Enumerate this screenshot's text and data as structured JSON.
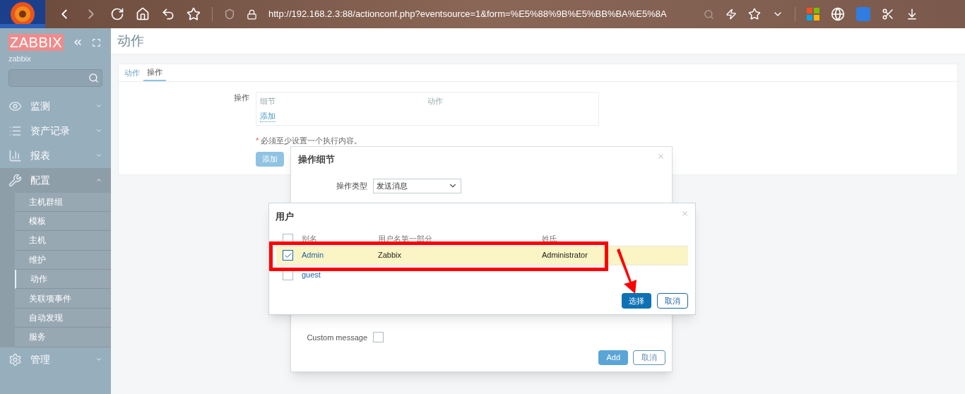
{
  "browser": {
    "url": "http://192.168.2.3:88/actionconf.php?eventsource=1&form=%E5%88%9B%E5%BB%BA%E5%8A"
  },
  "sidebar": {
    "logo": "ZABBIX",
    "user": "zabbix",
    "sections": [
      {
        "label": "监测",
        "expanded": false
      },
      {
        "label": "资产记录",
        "expanded": false
      },
      {
        "label": "报表",
        "expanded": false
      },
      {
        "label": "配置",
        "expanded": true,
        "children": [
          {
            "label": "主机群组",
            "selected": false
          },
          {
            "label": "模板",
            "selected": false
          },
          {
            "label": "主机",
            "selected": false
          },
          {
            "label": "维护",
            "selected": false
          },
          {
            "label": "动作",
            "selected": true
          },
          {
            "label": "关联项事件",
            "selected": false
          },
          {
            "label": "自动发现",
            "selected": false
          },
          {
            "label": "服务",
            "selected": false
          }
        ]
      },
      {
        "label": "管理",
        "expanded": false
      }
    ]
  },
  "page_title": "动作",
  "tabs": [
    {
      "label": "动作",
      "selected": false
    },
    {
      "label": "操作",
      "selected": true
    }
  ],
  "form": {
    "label": "操作",
    "columns": [
      "细节",
      "动作"
    ],
    "add_link": "添加",
    "required_mark": "*",
    "note": "必须至少设置一个执行内容。",
    "add_button": "添加"
  },
  "operation_dialog": {
    "title": "操作细节",
    "type_label": "操作类型",
    "type_value": "发送消息",
    "custom_message_label": "Custom message",
    "custom_message_checked": false,
    "buttons": [
      "Add",
      "取消"
    ]
  },
  "users_dialog": {
    "title": "用户",
    "columns": [
      "别名",
      "用户名第一部分",
      "姓氏"
    ],
    "all_checked": false,
    "rows": [
      {
        "alias": "Admin",
        "name": "Zabbix",
        "surname": "Administrator",
        "checked": true,
        "selected": true
      },
      {
        "alias": "guest",
        "name": "",
        "surname": "",
        "checked": false,
        "selected": false
      }
    ],
    "buttons": [
      "选择",
      "取消"
    ]
  }
}
